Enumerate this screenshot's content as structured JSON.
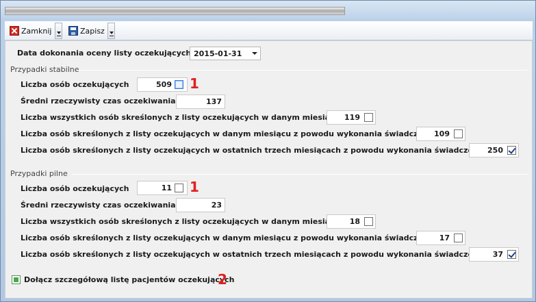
{
  "toolbar": {
    "close_label": "Zamknij",
    "save_label": "Zapisz"
  },
  "date": {
    "label": "Data dokonania oceny listy oczekujących",
    "value": "2015-01-31"
  },
  "stable": {
    "title": "Przypadki stabilne",
    "waiting_label": "Liczba osób oczekujących",
    "waiting_value": "509",
    "avg_label": "Średni rzeczywisty czas oczekiwania",
    "avg_value": "137",
    "removed_all_label": "Liczba wszystkich osób skreślonych z listy oczekujących w danym miesiącu",
    "removed_all_value": "119",
    "removed_service_label": "Liczba osób skreślonych z listy oczekujących w danym miesiącu z powodu wykonania świadczenia",
    "removed_service_value": "109",
    "removed_3m_label": "Liczba osób skreślonych z listy oczekujących w ostatnich trzech miesiącach z powodu wykonania świadczenia",
    "removed_3m_value": "250",
    "marker": "1"
  },
  "urgent": {
    "title": "Przypadki pilne",
    "waiting_label": "Liczba osób oczekujących",
    "waiting_value": "11",
    "avg_label": "Średni rzeczywisty czas oczekiwania",
    "avg_value": "23",
    "removed_all_label": "Liczba wszystkich osób skreślonych z listy oczekujących w danym miesiącu",
    "removed_all_value": "18",
    "removed_service_label": "Liczba osób skreślonych z listy oczekujących w danym miesiącu z powodu wykonania świadczenia",
    "removed_service_value": "17",
    "removed_3m_label": "Liczba osób skreślonych z listy oczekujących w ostatnich trzech miesiącach z powodu wykonania świadczenia",
    "removed_3m_value": "37",
    "marker": "1"
  },
  "attach": {
    "label": "Dołącz szczegółową listę pacjentów oczekujących",
    "marker": "2"
  }
}
